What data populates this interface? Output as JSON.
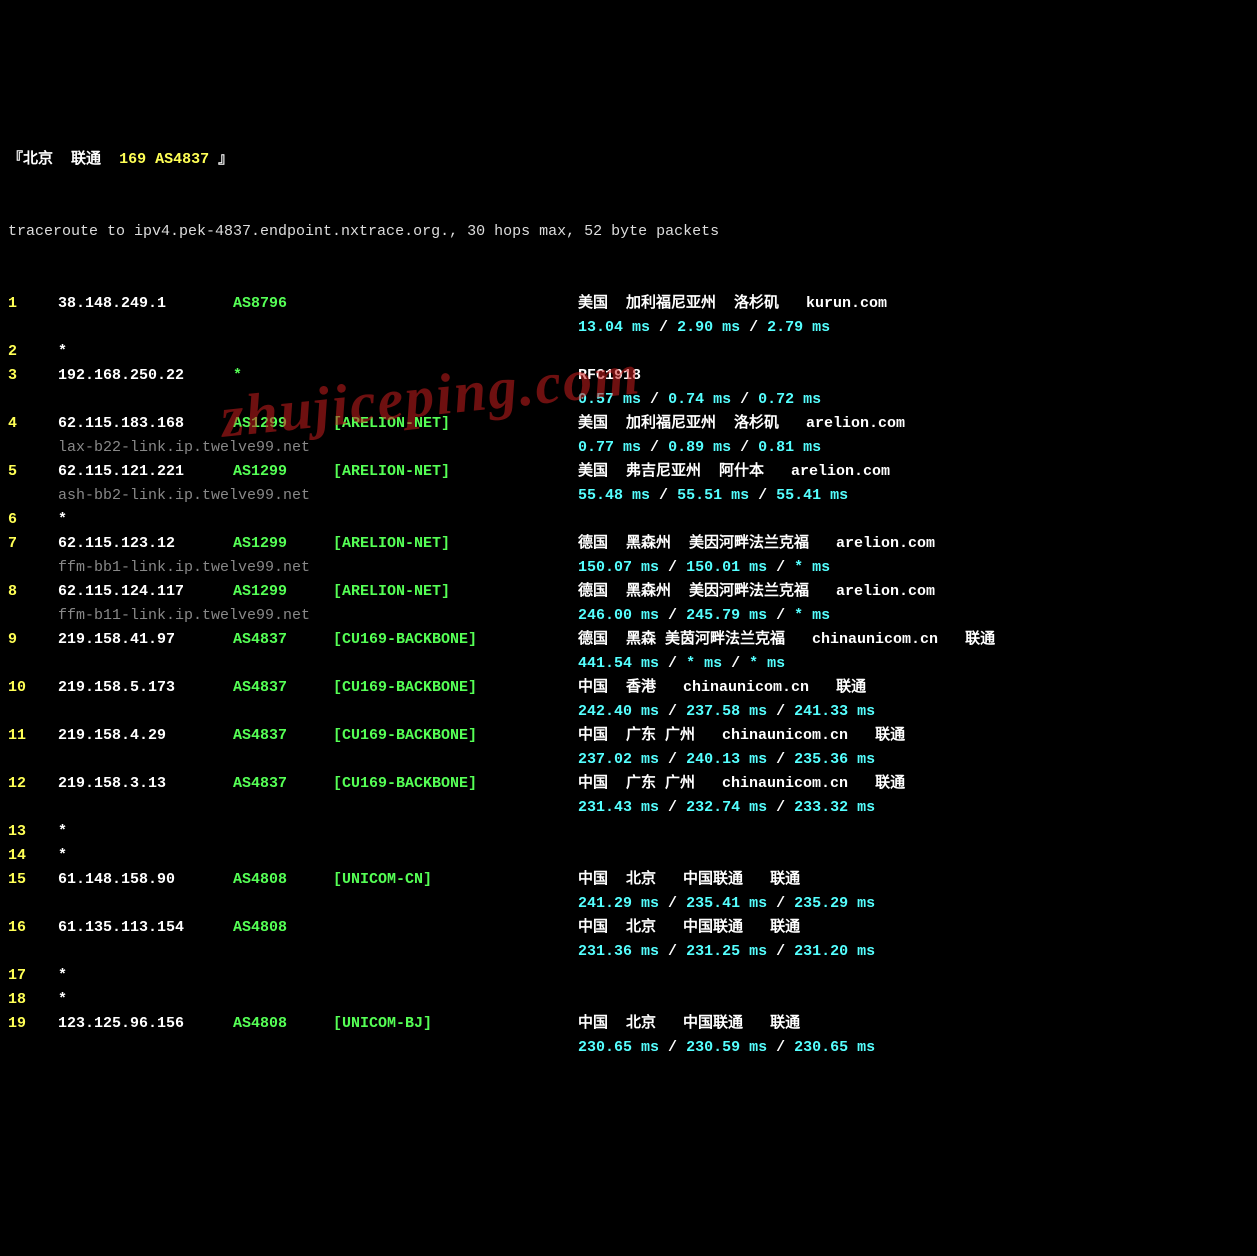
{
  "header": {
    "bracket_open": "『",
    "city": "北京",
    "isp": "联通",
    "code": "169 AS4837",
    "bracket_close": "』"
  },
  "trace_line": "traceroute to ipv4.pek-4837.endpoint.nxtrace.org., 30 hops max, 52 byte packets",
  "hops": [
    {
      "num": "1",
      "ip": "38.148.249.1",
      "as": "AS8796",
      "net": "",
      "geo": "美国  加利福尼亚州  洛杉矶",
      "host": "kurun.com",
      "extra": "",
      "ptr": "",
      "rtt": "13.04 ms / 2.90 ms / 2.79 ms"
    },
    {
      "num": "2",
      "ip": "*",
      "as": "",
      "net": "",
      "geo": "",
      "host": "",
      "extra": "",
      "ptr": "",
      "rtt": ""
    },
    {
      "num": "3",
      "ip": "192.168.250.22",
      "as": "*",
      "net": "",
      "geo": "RFC1918",
      "host": "",
      "extra": "",
      "ptr": "",
      "rtt": "0.57 ms / 0.74 ms / 0.72 ms"
    },
    {
      "num": "4",
      "ip": "62.115.183.168",
      "as": "AS1299",
      "net": "[ARELION-NET]",
      "geo": "美国  加利福尼亚州  洛杉矶",
      "host": "arelion.com",
      "extra": "",
      "ptr": "lax-b22-link.ip.twelve99.net",
      "rtt": "0.77 ms / 0.89 ms / 0.81 ms"
    },
    {
      "num": "5",
      "ip": "62.115.121.221",
      "as": "AS1299",
      "net": "[ARELION-NET]",
      "geo": "美国  弗吉尼亚州  阿什本",
      "host": "arelion.com",
      "extra": "",
      "ptr": "ash-bb2-link.ip.twelve99.net",
      "rtt": "55.48 ms / 55.51 ms / 55.41 ms"
    },
    {
      "num": "6",
      "ip": "*",
      "as": "",
      "net": "",
      "geo": "",
      "host": "",
      "extra": "",
      "ptr": "",
      "rtt": ""
    },
    {
      "num": "7",
      "ip": "62.115.123.12",
      "as": "AS1299",
      "net": "[ARELION-NET]",
      "geo": "德国  黑森州  美因河畔法兰克福",
      "host": "arelion.com",
      "extra": "",
      "ptr": "ffm-bb1-link.ip.twelve99.net",
      "rtt": "150.07 ms / 150.01 ms / * ms"
    },
    {
      "num": "8",
      "ip": "62.115.124.117",
      "as": "AS1299",
      "net": "[ARELION-NET]",
      "geo": "德国  黑森州  美因河畔法兰克福",
      "host": "arelion.com",
      "extra": "",
      "ptr": "ffm-b11-link.ip.twelve99.net",
      "rtt": "246.00 ms / 245.79 ms / * ms"
    },
    {
      "num": "9",
      "ip": "219.158.41.97",
      "as": "AS4837",
      "net": "[CU169-BACKBONE]",
      "geo": "德国  黑森 美茵河畔法兰克福",
      "host": "chinaunicom.cn",
      "extra": "联通",
      "ptr": "",
      "rtt": "441.54 ms / * ms / * ms"
    },
    {
      "num": "10",
      "ip": "219.158.5.173",
      "as": "AS4837",
      "net": "[CU169-BACKBONE]",
      "geo": "中国  香港",
      "host": "chinaunicom.cn",
      "extra": "联通",
      "ptr": "",
      "rtt": "242.40 ms / 237.58 ms / 241.33 ms"
    },
    {
      "num": "11",
      "ip": "219.158.4.29",
      "as": "AS4837",
      "net": "[CU169-BACKBONE]",
      "geo": "中国  广东 广州",
      "host": "chinaunicom.cn",
      "extra": "联通",
      "ptr": "",
      "rtt": "237.02 ms / 240.13 ms / 235.36 ms"
    },
    {
      "num": "12",
      "ip": "219.158.3.13",
      "as": "AS4837",
      "net": "[CU169-BACKBONE]",
      "geo": "中国  广东 广州",
      "host": "chinaunicom.cn",
      "extra": "联通",
      "ptr": "",
      "rtt": "231.43 ms / 232.74 ms / 233.32 ms"
    },
    {
      "num": "13",
      "ip": "*",
      "as": "",
      "net": "",
      "geo": "",
      "host": "",
      "extra": "",
      "ptr": "",
      "rtt": ""
    },
    {
      "num": "14",
      "ip": "*",
      "as": "",
      "net": "",
      "geo": "",
      "host": "",
      "extra": "",
      "ptr": "",
      "rtt": ""
    },
    {
      "num": "15",
      "ip": "61.148.158.90",
      "as": "AS4808",
      "net": "[UNICOM-CN]",
      "geo": "中国  北京",
      "host": "中国联通",
      "extra": "联通",
      "ptr": "",
      "rtt": "241.29 ms / 235.41 ms / 235.29 ms"
    },
    {
      "num": "16",
      "ip": "61.135.113.154",
      "as": "AS4808",
      "net": "",
      "geo": "中国  北京",
      "host": "中国联通",
      "extra": "联通",
      "ptr": "",
      "rtt": "231.36 ms / 231.25 ms / 231.20 ms"
    },
    {
      "num": "17",
      "ip": "*",
      "as": "",
      "net": "",
      "geo": "",
      "host": "",
      "extra": "",
      "ptr": "",
      "rtt": ""
    },
    {
      "num": "18",
      "ip": "*",
      "as": "",
      "net": "",
      "geo": "",
      "host": "",
      "extra": "",
      "ptr": "",
      "rtt": ""
    },
    {
      "num": "19",
      "ip": "123.125.96.156",
      "as": "AS4808",
      "net": "[UNICOM-BJ]",
      "geo": "中国  北京",
      "host": "中国联通",
      "extra": "联通",
      "ptr": "",
      "rtt": "230.65 ms / 230.59 ms / 230.65 ms"
    }
  ],
  "watermark": "zhujiceping.com"
}
